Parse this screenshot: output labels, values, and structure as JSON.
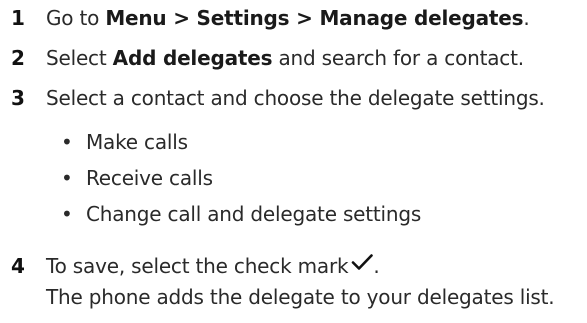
{
  "steps": [
    {
      "number": "1",
      "prefix": "Go to ",
      "bold": "Menu > Settings > Manage delegates",
      "suffix": "."
    },
    {
      "number": "2",
      "prefix": "Select ",
      "bold": "Add delegates",
      "suffix": " and search for a contact."
    },
    {
      "number": "3",
      "text": "Select a contact and choose the delegate settings."
    },
    {
      "number": "4",
      "text": "To save, select the check mark",
      "after_icon": ".",
      "icon": "check-icon",
      "continuation": "The phone adds the delegate to your delegates list."
    }
  ],
  "bullets": [
    "Make calls",
    "Receive calls",
    "Change call and delegate settings"
  ],
  "bullet_char": "•"
}
